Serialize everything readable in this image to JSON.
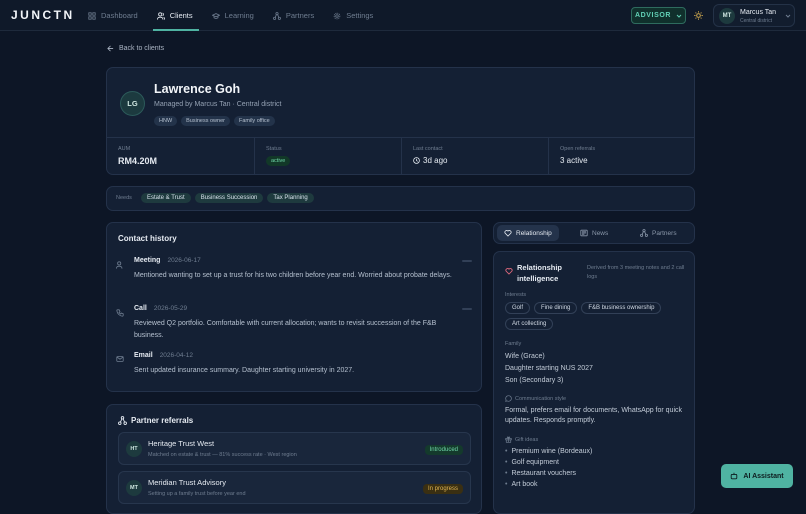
{
  "app": {
    "logo": "JUNCTN"
  },
  "nav": {
    "items": [
      {
        "label": "Dashboard",
        "icon": "grid-icon"
      },
      {
        "label": "Clients",
        "icon": "users-icon",
        "active": true
      },
      {
        "label": "Learning",
        "icon": "graduation-cap-icon"
      },
      {
        "label": "Partners",
        "icon": "network-icon"
      },
      {
        "label": "Settings",
        "icon": "gear-icon"
      }
    ]
  },
  "header": {
    "role_label": "ADVISOR",
    "theme_icon": "sun-icon"
  },
  "user": {
    "initials": "MT",
    "name": "Marcus Tan",
    "district": "Central district"
  },
  "back_link": "Back to clients",
  "client": {
    "initials": "LG",
    "name": "Lawrence Goh",
    "subtitle": "Managed by Marcus Tan · Central district",
    "tags": [
      "HNW",
      "Business owner",
      "Family office"
    ],
    "stats": [
      {
        "label": "AUM",
        "value": "RM4.20M"
      },
      {
        "label": "Status",
        "value": "active"
      },
      {
        "label": "Last contact",
        "value": "3d ago"
      },
      {
        "label": "Open referrals",
        "value": "3 active"
      }
    ]
  },
  "needs": {
    "label": "Needs",
    "tags": [
      "Estate & Trust",
      "Business Succession",
      "Tax Planning"
    ]
  },
  "contact_history": {
    "title": "Contact history",
    "events": [
      {
        "type": "Meeting",
        "date": "2026-06-17",
        "icon": "users-icon",
        "text": "Mentioned wanting to set up a trust for his two children before year end. Worried about probate delays."
      },
      {
        "type": "Call",
        "date": "2026-05-29",
        "icon": "phone-icon",
        "text": "Reviewed Q2 portfolio. Comfortable with current allocation; wants to revisit succession of the F&B business."
      },
      {
        "type": "Email",
        "date": "2026-04-12",
        "icon": "mail-icon",
        "text": "Sent updated insurance summary. Daughter starting university in 2027."
      }
    ]
  },
  "partner_referrals": {
    "title": "Partner referrals",
    "items": [
      {
        "initials": "HT",
        "name": "Heritage Trust West",
        "sub": "Matched on estate & trust — 81% success rate · West region",
        "status": "Introduced",
        "status_color": "#6fd7a8"
      },
      {
        "initials": "MT",
        "name": "Meridian Trust Advisory",
        "sub": "Setting up a family trust before year end",
        "status": "In progress",
        "status_color": "#e0b552"
      }
    ]
  },
  "side_tabs": [
    {
      "label": "Relationship",
      "icon": "heart-icon",
      "active": true
    },
    {
      "label": "News",
      "icon": "newspaper-icon"
    },
    {
      "label": "Partners",
      "icon": "network-icon"
    }
  ],
  "intel": {
    "title": "Relationship intelligence",
    "note": "Derived from 3 meeting notes and 2 call logs",
    "interests_label": "Interests",
    "interests": [
      "Golf",
      "Fine dining",
      "F&B business ownership",
      "Art collecting"
    ],
    "family_label": "Family",
    "family": [
      "Wife (Grace)",
      "Daughter starting NUS 2027",
      "Son (Secondary 3)"
    ],
    "comm_label": "Communication style",
    "comm_text": "Formal, prefers email for documents, WhatsApp for quick updates. Responds promptly.",
    "gifts_label": "Gift ideas",
    "gifts": [
      "Premium wine (Bordeaux)",
      "Golf equipment",
      "Restaurant vouchers",
      "Art book"
    ]
  },
  "ai_button": "AI Assistant",
  "colors": {
    "accent": "#4fb3a2",
    "background": "#0d1626",
    "card": "#142034"
  }
}
